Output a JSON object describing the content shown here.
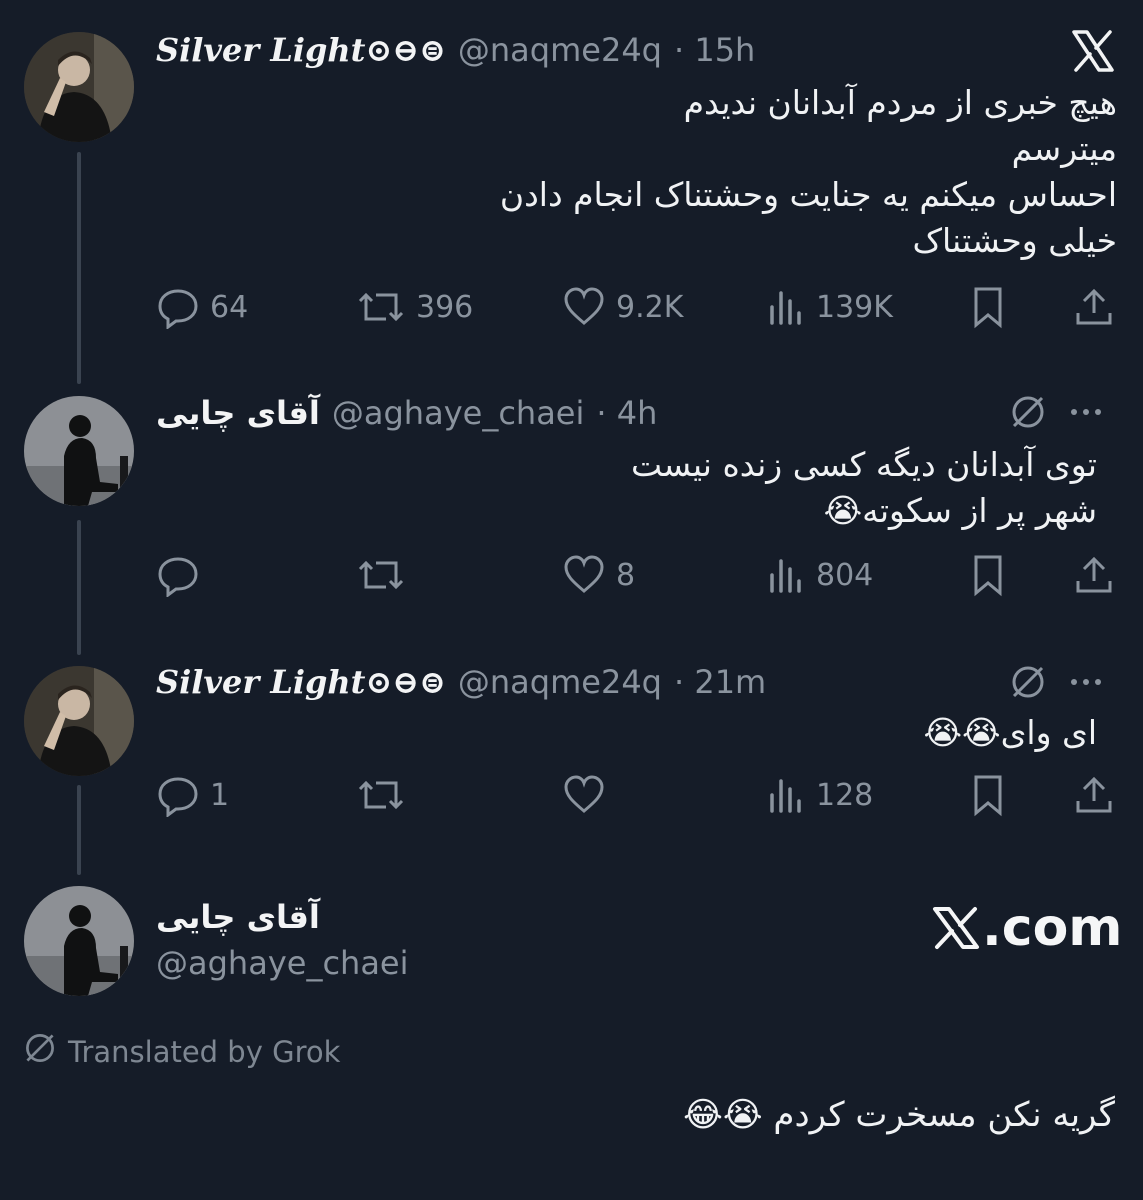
{
  "colors": {
    "background": "#151c28",
    "text": "#e7e9ea",
    "muted": "#8a939e",
    "thread_line": "#3a4350"
  },
  "x_logo_icon": "x-logo",
  "tweets": [
    {
      "name": "Silver Light⊙⊖⊜",
      "handle": "@naqme24q",
      "time": "· 15h",
      "text": "هیچ خبری از مردم آبدانان ندیدم\nمیترسم\nاحساس میکنم یه جنایت وحشتناک انجام دادن\nخیلی وحشتناک",
      "replies": "64",
      "reposts": "396",
      "likes": "9.2K",
      "views": "139K"
    },
    {
      "name": "آقای چایی",
      "handle": "@aghaye_chaei",
      "time": "· 4h",
      "text": "توی آبدانان دیگه کسی زنده نیست\nشهر پر از سکوته😭",
      "replies": "",
      "reposts": "",
      "likes": "8",
      "views": "804"
    },
    {
      "name": "Silver Light⊙⊖⊜",
      "handle": "@naqme24q",
      "time": "· 21m",
      "text": "ای وای😭😭",
      "replies": "1",
      "reposts": "",
      "likes": "",
      "views": "128"
    }
  ],
  "main_tweet": {
    "name": "آقای چایی",
    "handle": "@aghaye_chaei",
    "site_label": ".com",
    "translated_label": "Translated by Grok",
    "text": "گریه نکن مسخرت کردم 😭😂"
  }
}
